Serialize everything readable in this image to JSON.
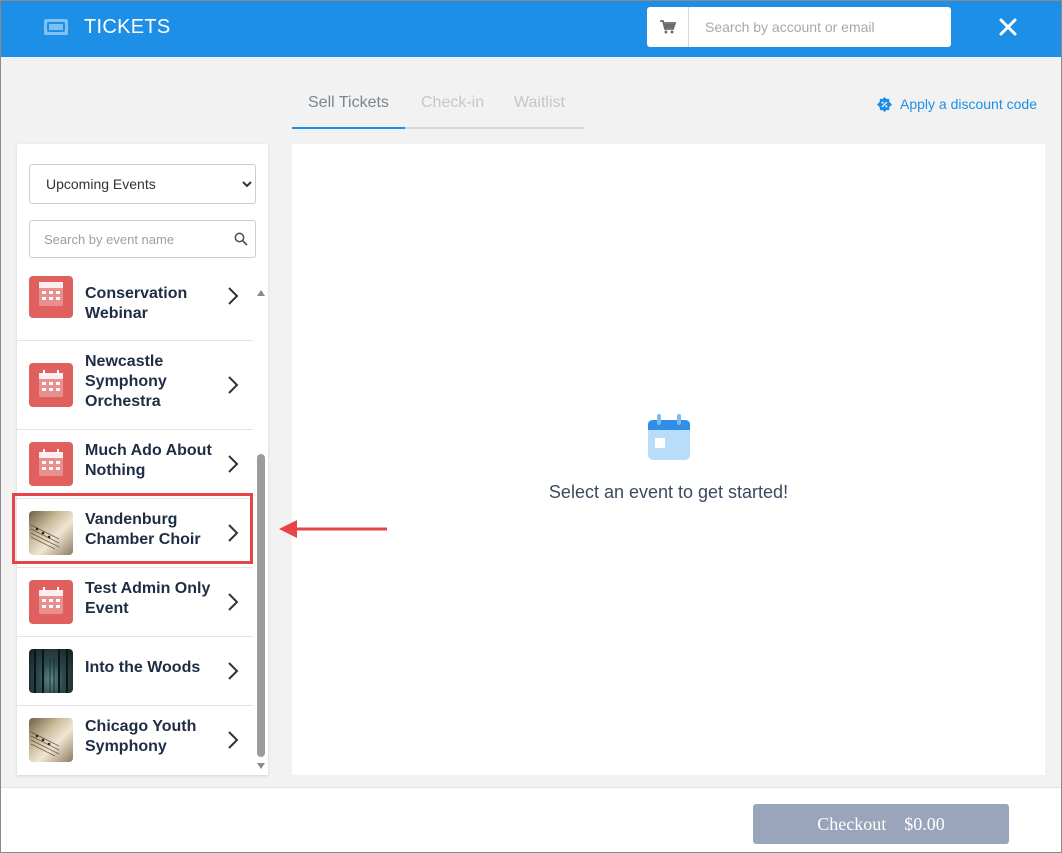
{
  "header": {
    "title": "TICKETS",
    "search_placeholder": "Search by account or email"
  },
  "tabs": [
    {
      "label": "Sell Tickets",
      "active": true
    },
    {
      "label": "Check-in",
      "active": false
    },
    {
      "label": "Waitlist",
      "active": false
    }
  ],
  "discount_label": "Apply a discount code",
  "sidebar": {
    "filter_selected": "Upcoming Events",
    "search_placeholder": "Search by event name",
    "events": [
      {
        "name": "Conservation Webinar",
        "thumb": "calendar-icon"
      },
      {
        "name": "Newcastle Symphony Orchestra",
        "thumb": "calendar-icon"
      },
      {
        "name": "Much Ado About Nothing",
        "thumb": "calendar-icon"
      },
      {
        "name": "Vandenburg Chamber Choir",
        "thumb": "sheet-music-photo",
        "highlighted": true
      },
      {
        "name": "Test Admin Only Event",
        "thumb": "calendar-icon"
      },
      {
        "name": "Into the Woods",
        "thumb": "forest-photo"
      },
      {
        "name": "Chicago Youth Symphony",
        "thumb": "sheet-music-photo"
      }
    ]
  },
  "main": {
    "empty_message": "Select an event to get started!"
  },
  "footer": {
    "checkout_label": "Checkout",
    "checkout_total": "$0.00"
  },
  "colors": {
    "header": "#1e8fe6",
    "accent": "#1e8fe6",
    "calendar_thumb": "#e0605f",
    "highlight": "#e54548",
    "checkout_button": "#9aa5bb",
    "event_text": "#1e2d44"
  }
}
